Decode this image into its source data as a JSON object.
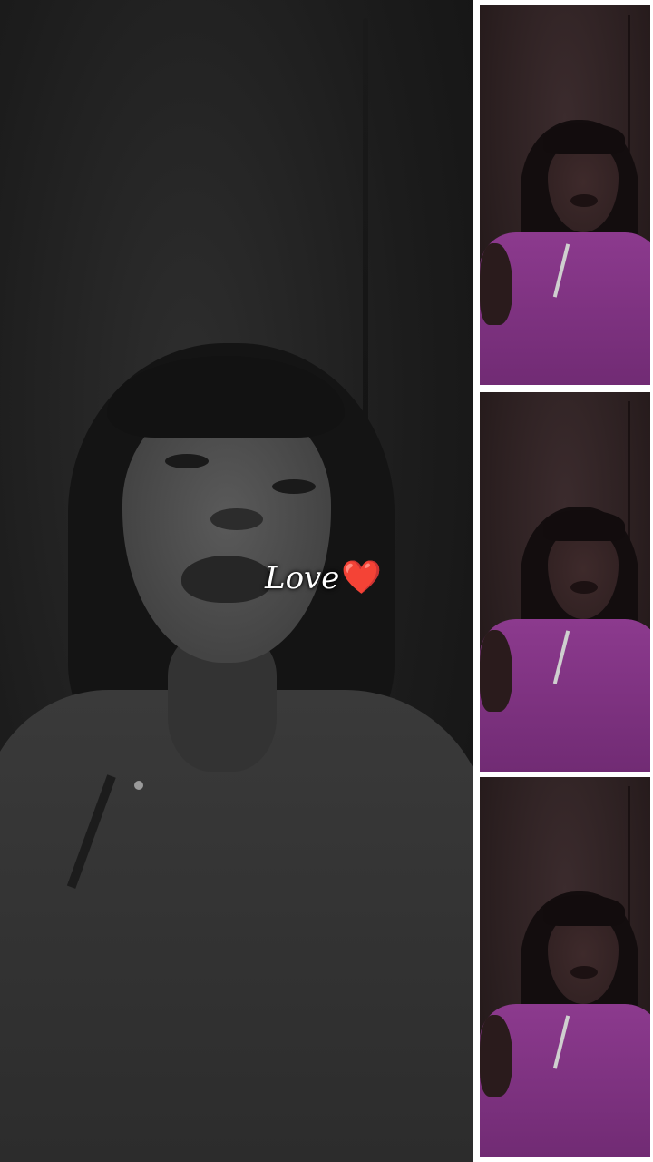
{
  "caption": {
    "text": "Love",
    "emoji": "❤️"
  },
  "thumbnails": [
    {
      "name": "portrait-thumbnail-1"
    },
    {
      "name": "portrait-thumbnail-2"
    },
    {
      "name": "portrait-thumbnail-3"
    }
  ],
  "colors": {
    "heart": "#d9182b",
    "shirt": "#8c3a8e",
    "frame": "#ffffff"
  }
}
